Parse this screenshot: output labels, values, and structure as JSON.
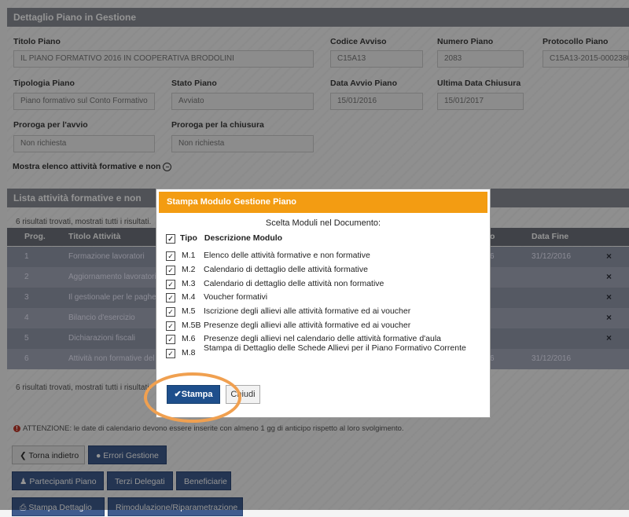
{
  "piano": {
    "panel_title": "Dettaglio Piano in Gestione",
    "titolo_label": "Titolo Piano",
    "titolo_value": "IL PIANO FORMATIVO 2016 IN COOPERATIVA BRODOLINI",
    "codice_label": "Codice Avviso",
    "codice_value": "C15A13",
    "numero_label": "Numero Piano",
    "numero_value": "2083",
    "protocollo_label": "Protocollo Piano",
    "protocollo_value": "C15A13-2015-0002380",
    "tipologia_label": "Tipologia Piano",
    "tipologia_value": "Piano formativo sul Conto Formativo",
    "stato_label": "Stato Piano",
    "stato_value": "Avviato",
    "avvio_label": "Data Avvio Piano",
    "avvio_value": "15/01/2016",
    "chiusura_label": "Ultima Data Chiusura",
    "chiusura_value": "15/01/2017",
    "proroga_avvio_label": "Proroga per l'avvio",
    "proroga_avvio_value": "Non richiesta",
    "proroga_chiusura_label": "Proroga per la chiusura",
    "proroga_chiusura_value": "Non richiesta",
    "mostra_link": "Mostra elenco attività formative e non",
    "mostra_icon": "minus-circle-icon"
  },
  "lista": {
    "title": "Lista attività formative e non",
    "found_text": "6 risultati trovati, mostrati tutti i risultati.",
    "found_text_short": "6 risultati trovati, mostrati tutti i risultati.",
    "columns": {
      "prog": "Prog.",
      "titolo": "Titolo Attività",
      "col_o": "o",
      "data_fine": "Data Fine"
    },
    "rows": [
      {
        "prog": "1",
        "titolo": "Formazione lavoratori",
        "col6": "6",
        "data_fine": "31/12/2016",
        "remove": "×"
      },
      {
        "prog": "2",
        "titolo": "Aggiornamento lavoratori",
        "col6": "",
        "data_fine": "",
        "remove": "×"
      },
      {
        "prog": "3",
        "titolo": "Il gestionale per le paghe",
        "col6": "",
        "data_fine": "",
        "remove": "×"
      },
      {
        "prog": "4",
        "titolo": "Bilancio d'esercizio",
        "col6": "",
        "data_fine": "",
        "remove": "×"
      },
      {
        "prog": "5",
        "titolo": "Dichiarazioni fiscali",
        "col6": "",
        "data_fine": "",
        "remove": "×"
      },
      {
        "prog": "6",
        "titolo": "Attività non formative del",
        "col6": "6",
        "data_fine": "31/12/2016",
        "remove": ""
      }
    ]
  },
  "warning": "ATTENZIONE: le date di calendario devono essere inserite con almeno 1 gg di anticipo rispetto al loro svolgimento.",
  "buttons": {
    "torna": "Torna indietro",
    "errori": "Errori Gestione",
    "partecipanti": "Partecipanti Piano",
    "terzi": "Terzi Delegati",
    "beneficiarie": "Beneficiarie",
    "stampa_dettaglio": "Stampa Dettaglio",
    "rimodulazione": "Rimodulazione/Riparametrazione"
  },
  "modal": {
    "title": "Stampa Modulo Gestione Piano",
    "subtitle": "Scelta Moduli nel Documento:",
    "header_tipo": "Tipo",
    "header_desc": "Descrizione Modulo",
    "modules": [
      {
        "code": "M.1",
        "desc": "Elenco delle attività formative e non formative",
        "checked": true
      },
      {
        "code": "M.2",
        "desc": "Calendario di dettaglio delle attività formative",
        "checked": true
      },
      {
        "code": "M.3",
        "desc": "Calendario di dettaglio delle attività non formative",
        "checked": true
      },
      {
        "code": "M.4",
        "desc": "Voucher formativi",
        "checked": true
      },
      {
        "code": "M.5",
        "desc": "Iscrizione degli allievi alle attività formative ed ai voucher",
        "checked": true
      },
      {
        "code": "M.5B",
        "desc": "Presenze degli allievi alle attività formative ed ai voucher",
        "checked": true
      },
      {
        "code": "M.6",
        "desc": "Presenze degli allievi nel calendario delle attività formative d'aula",
        "checked": true
      },
      {
        "code": "M.8",
        "desc": "Stampa di Dettaglio delle Schede Allievi per il Piano Formativo Corrente",
        "checked": true
      }
    ],
    "stampa_label": "Stampa",
    "chiudi_label": "Chiudi"
  },
  "colors": {
    "accent": "#f39c12",
    "primary": "#1e4f8c",
    "highlight_ring": "#f0a050"
  }
}
